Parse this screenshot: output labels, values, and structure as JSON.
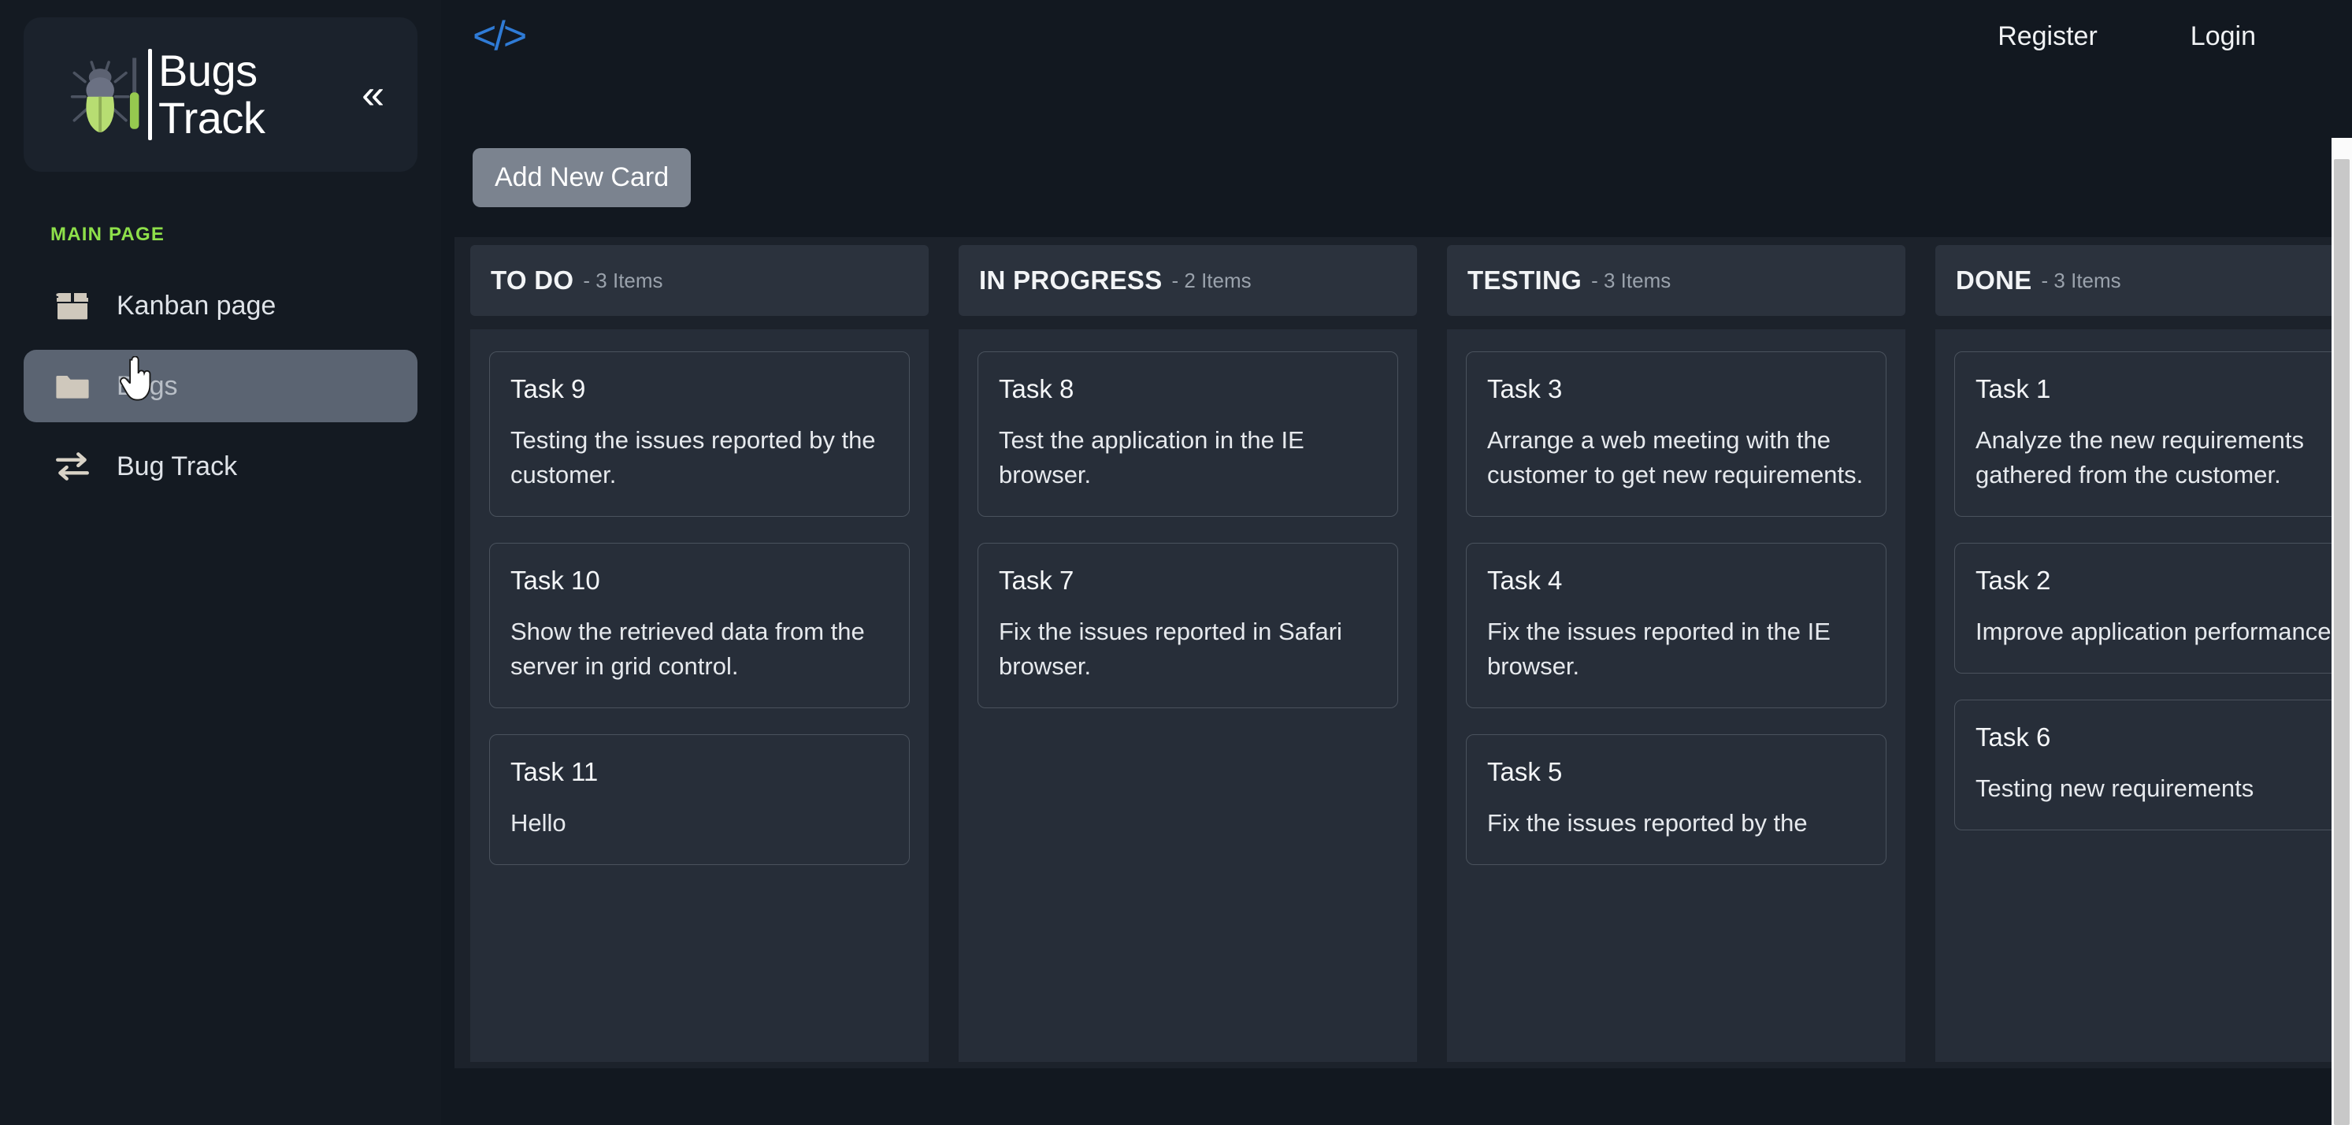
{
  "sidebar": {
    "brand": {
      "title": "Bugs\nTrack",
      "logo_icon": "bug-screwdriver-icon",
      "collapse_icon": "«"
    },
    "section_label": "MAIN PAGE",
    "items": [
      {
        "label": "Kanban page",
        "icon": "box-icon",
        "active": false
      },
      {
        "label": "Bugs",
        "icon": "folder-icon",
        "active": true
      },
      {
        "label": "Bug Track",
        "icon": "transfer-arrows-icon",
        "active": false
      }
    ]
  },
  "topbar": {
    "code_icon": "</>",
    "register_label": "Register",
    "login_label": "Login"
  },
  "toolbar": {
    "add_card_label": "Add New Card"
  },
  "board": {
    "columns": [
      {
        "title": "TO DO",
        "count_label": "- 3 Items",
        "cards": [
          {
            "title": "Task 9",
            "desc": "Testing the issues reported by the customer."
          },
          {
            "title": "Task 10",
            "desc": "Show the retrieved data from the server in grid control."
          },
          {
            "title": "Task 11",
            "desc": "Hello"
          }
        ]
      },
      {
        "title": "IN PROGRESS",
        "count_label": "- 2 Items",
        "cards": [
          {
            "title": "Task 8",
            "desc": "Test the application in the IE browser."
          },
          {
            "title": "Task 7",
            "desc": "Fix the issues reported in Safari browser."
          }
        ]
      },
      {
        "title": "TESTING",
        "count_label": "- 3 Items",
        "cards": [
          {
            "title": "Task 3",
            "desc": "Arrange a web meeting with the customer to get new requirements."
          },
          {
            "title": "Task 4",
            "desc": "Fix the issues reported in the IE browser."
          },
          {
            "title": "Task 5",
            "desc": "Fix the issues reported by the"
          }
        ]
      },
      {
        "title": "DONE",
        "count_label": "- 3 Items",
        "cards": [
          {
            "title": "Task 1",
            "desc": "Analyze the new requirements gathered from the customer."
          },
          {
            "title": "Task 2",
            "desc": "Improve application performance"
          },
          {
            "title": "Task 6",
            "desc": "Testing new requirements"
          }
        ]
      }
    ]
  },
  "colors": {
    "page_bg": "#121820",
    "sidebar_bg": "#141a22",
    "accent_green": "#8ee04a",
    "accent_blue": "#2f7bd6",
    "board_bg": "#1c222b",
    "column_bg": "#262d38",
    "card_bg": "#272e39",
    "active_nav": "#5b6472",
    "button_bg": "#7b838f"
  }
}
